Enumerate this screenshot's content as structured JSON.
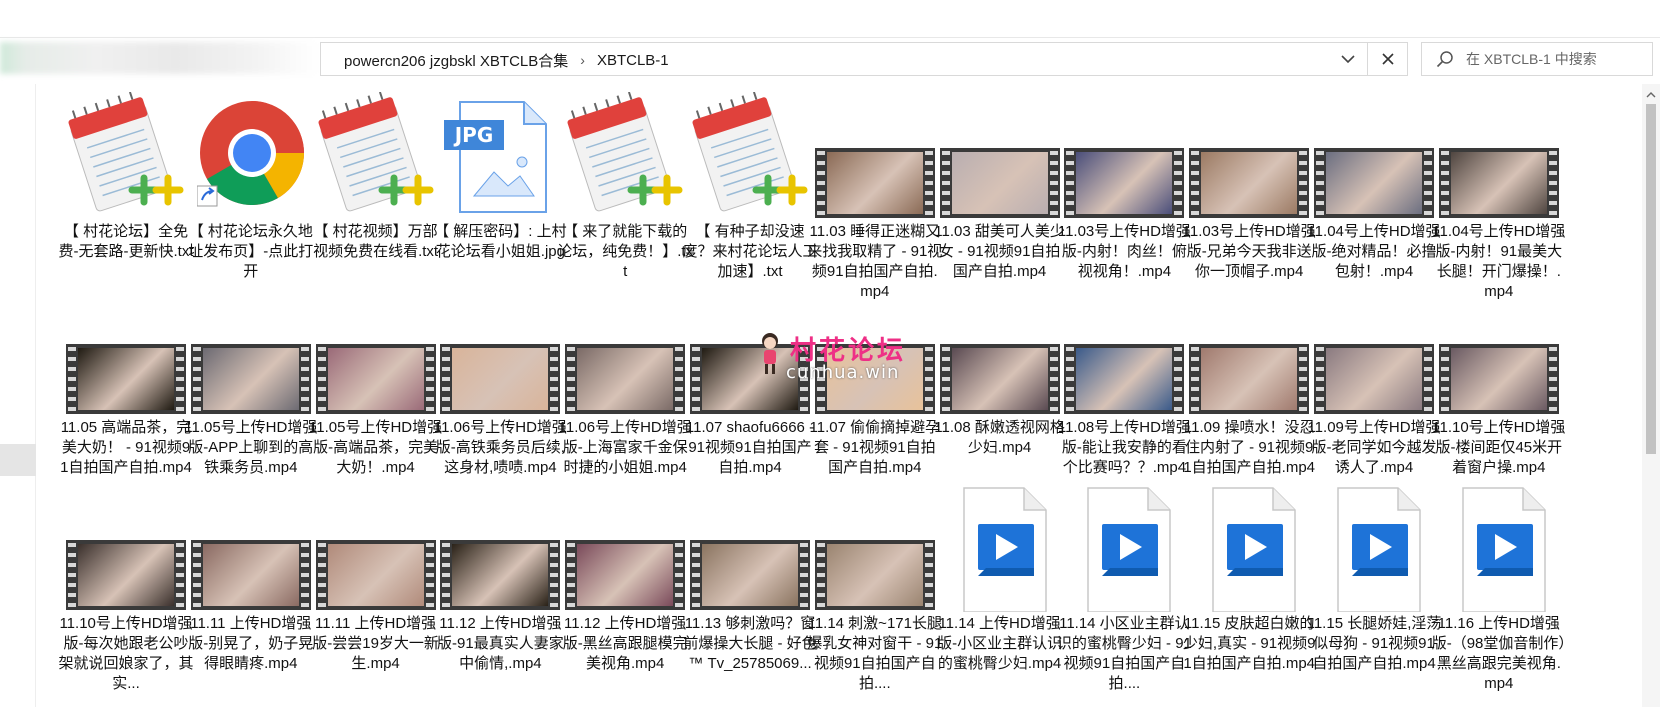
{
  "address": {
    "crumbs": [
      "powercn206 jzgbskl XBTCLB合集",
      "XBTCLB-1"
    ]
  },
  "search": {
    "placeholder": "在 XBTCLB-1 中搜索"
  },
  "watermark": {
    "text": "村花论坛",
    "url": "cunhua.win"
  },
  "colors": {
    "accent": "#0078d4",
    "watermark": "#ee2f86"
  },
  "files": [
    {
      "name": "【 村花论坛】全免费-无套路-更新快.txt",
      "type": "notepad"
    },
    {
      "name": "【 村花论坛永久地址发布页】-点此打开",
      "type": "chrome"
    },
    {
      "name": "【 村花视频】万部视频免费在线看.txt",
      "type": "notepad"
    },
    {
      "name": "【 解压密码】: 上村花论坛看小姐姐.jpg",
      "type": "jpg"
    },
    {
      "name": "【 来了就能下载的论坛，纯免费！】.txt",
      "type": "notepad"
    },
    {
      "name": "【 有种子却没速度？来村花论坛人工加速】.txt",
      "type": "notepad"
    },
    {
      "name": "11.03 睡得正迷糊又来找我取精了 - 91视频91自拍国产自拍.mp4",
      "type": "video",
      "tone": "#8a6a55"
    },
    {
      "name": "11.03 甜美可人美少女 - 91视频91自拍国产自拍.mp4",
      "type": "video",
      "tone": "#b9aeb0"
    },
    {
      "name": "11.03号上传HD增强版-内射！肉丝！俯视视角！.mp4",
      "type": "video",
      "tone": "#4a4e7a"
    },
    {
      "name": "11.03号上传HD增强版-兄弟今天我非送你一顶帽子.mp4",
      "type": "video",
      "tone": "#9b7a63"
    },
    {
      "name": "11.04号上传HD增强版-绝对精品！必撸包射！.mp4",
      "type": "video",
      "tone": "#6b6e80"
    },
    {
      "name": "11.04号上传HD增强版-内射！91最美大长腿！开门爆操！.mp4",
      "type": "video",
      "tone": "#4f4540"
    },
    {
      "name": "11.05 高端品茶，完美大奶！ - 91视频91自拍国产自拍.mp4",
      "type": "video",
      "tone": "#1f1a12"
    },
    {
      "name": "11.05号上传HD增强版-APP上聊到的高铁乘务员.mp4",
      "type": "video",
      "tone": "#6c6a72"
    },
    {
      "name": "11.05号上传HD增强版-高端品茶，完美大奶！.mp4",
      "type": "video",
      "tone": "#9a6a78"
    },
    {
      "name": "11.06号上传HD增强版-高铁乘务员后续,这身材,啧啧.mp4",
      "type": "video",
      "tone": "#d9b49a"
    },
    {
      "name": "11.06号上传HD增强版-上海富家千金保时捷的小姐姐.mp4",
      "type": "video",
      "tone": "#7a6a66"
    },
    {
      "name": "11.07 shaofu6666 - 91视频91自拍国产自拍.mp4",
      "type": "video",
      "tone": "#1f1a12"
    },
    {
      "name": "11.07 偷偷摘掉避孕套 - 91视频91自拍国产自拍.mp4",
      "type": "video",
      "tone": "#e8c29a"
    },
    {
      "name": "11.08 酥嫩透视网格少妇.mp4",
      "type": "video",
      "tone": "#5a4a52"
    },
    {
      "name": "11.08号上传HD增强版-能让我安静的看个比赛吗？？.mp4",
      "type": "video",
      "tone": "#3a5a8a"
    },
    {
      "name": "11.09 操喷水！没忍住内射了 - 91视频91自拍国产自拍.mp4",
      "type": "video",
      "tone": "#a07a6e"
    },
    {
      "name": "11.09号上传HD增强版-老同学如今越发诱人了.mp4",
      "type": "video",
      "tone": "#8a7a80"
    },
    {
      "name": "11.10号上传HD增强版-楼间距仅45米开着窗户操.mp4",
      "type": "video",
      "tone": "#6a5a62"
    },
    {
      "name": "11.10号上传HD增强版-每次她跟老公吵架就说回娘家了，其实...",
      "type": "video",
      "tone": "#3a302c"
    },
    {
      "name": "11.11 上传HD增强版-别晃了，奶子晃得眼睛疼.mp4",
      "type": "video",
      "tone": "#8a6a62"
    },
    {
      "name": "11.11 上传HD增强版-尝尝19岁大一新生.mp4",
      "type": "video",
      "tone": "#b08a7a"
    },
    {
      "name": "11.12 上传HD增强版-91最真实人妻家中偷情,.mp4",
      "type": "video",
      "tone": "#2a2218"
    },
    {
      "name": "11.12 上传HD增强版-黑丝高跟腿模完美视角.mp4",
      "type": "video",
      "tone": "#7a4a5a"
    },
    {
      "name": "11.13 够刺激吗？窗前爆操大长腿 - 好色™ Tv_25785069...",
      "type": "video",
      "tone": "#8a7460"
    },
    {
      "name": "11.14 刺激~171长腿爆乳女神对窗干 - 91视频91自拍国产自拍....",
      "type": "video",
      "tone": "#9a8470"
    },
    {
      "name": "11.14 上传HD增强版-小区业主群认识的蜜桃臀少妇.mp4",
      "type": "mediafile"
    },
    {
      "name": "11.14 小区业主群认识的蜜桃臀少妇 - 91视频91自拍国产自拍....",
      "type": "mediafile"
    },
    {
      "name": "11.15 皮肤超白嫩的少妇,真实 - 91视频91自拍国产自拍.mp4",
      "type": "mediafile"
    },
    {
      "name": "11.15 长腿娇娃,淫荡似母狗 - 91视频91自拍国产自拍.mp4",
      "type": "mediafile"
    },
    {
      "name": "11.16 上传HD增强版-（98堂伽音制作）黑丝高跟完美视角.mp4",
      "type": "mediafile"
    }
  ]
}
